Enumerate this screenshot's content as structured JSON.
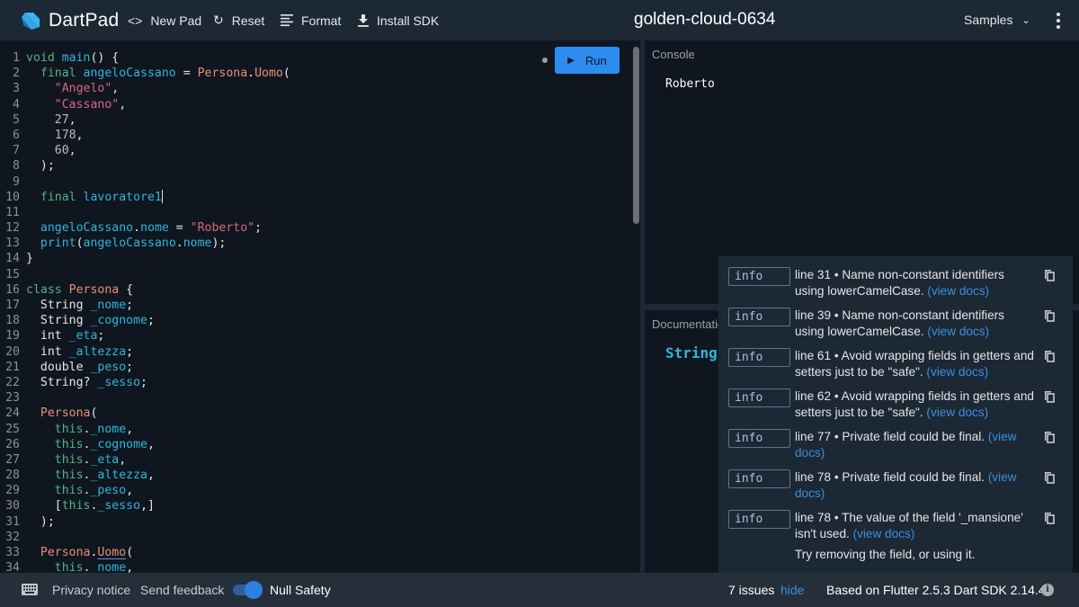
{
  "header": {
    "app_name": "DartPad",
    "new_pad_label": "New Pad",
    "reset_label": "Reset",
    "format_label": "Format",
    "install_sdk_label": "Install SDK",
    "pad_title": "golden-cloud-0634",
    "samples_label": "Samples"
  },
  "editor": {
    "run_label": "Run",
    "lines": [
      {
        "n": "1",
        "tokens": [
          [
            "kw",
            "void "
          ],
          [
            "id",
            "main"
          ],
          [
            "pl",
            "() {"
          ]
        ]
      },
      {
        "n": "2",
        "tokens": [
          [
            "pl",
            "  "
          ],
          [
            "kw",
            "final "
          ],
          [
            "id",
            "angeloCassano"
          ],
          [
            "pl",
            " = "
          ],
          [
            "ty",
            "Persona"
          ],
          [
            "pl",
            "."
          ],
          [
            "ty",
            "Uomo"
          ],
          [
            "pl",
            "("
          ]
        ]
      },
      {
        "n": "3",
        "tokens": [
          [
            "pl",
            "    "
          ],
          [
            "str",
            "\"Angelo\""
          ],
          [
            "pl",
            ","
          ]
        ]
      },
      {
        "n": "4",
        "tokens": [
          [
            "pl",
            "    "
          ],
          [
            "str",
            "\"Cassano\""
          ],
          [
            "pl",
            ","
          ]
        ]
      },
      {
        "n": "5",
        "tokens": [
          [
            "pl",
            "    "
          ],
          [
            "num",
            "27"
          ],
          [
            "pl",
            ","
          ]
        ]
      },
      {
        "n": "6",
        "tokens": [
          [
            "pl",
            "    "
          ],
          [
            "num",
            "178"
          ],
          [
            "pl",
            ","
          ]
        ]
      },
      {
        "n": "7",
        "tokens": [
          [
            "pl",
            "    "
          ],
          [
            "num",
            "60"
          ],
          [
            "pl",
            ","
          ]
        ]
      },
      {
        "n": "8",
        "tokens": [
          [
            "pl",
            "  );"
          ]
        ]
      },
      {
        "n": "9",
        "tokens": []
      },
      {
        "n": "10",
        "tokens": [
          [
            "pl",
            "  "
          ],
          [
            "kw",
            "final "
          ],
          [
            "id",
            "lavoratore1"
          ],
          [
            "cursor",
            ""
          ]
        ]
      },
      {
        "n": "11",
        "tokens": []
      },
      {
        "n": "12",
        "tokens": [
          [
            "pl",
            "  "
          ],
          [
            "id",
            "angeloCassano"
          ],
          [
            "pl",
            "."
          ],
          [
            "id",
            "nome"
          ],
          [
            "pl",
            " = "
          ],
          [
            "str",
            "\"Roberto\""
          ],
          [
            "pl",
            ";"
          ]
        ]
      },
      {
        "n": "13",
        "tokens": [
          [
            "pl",
            "  "
          ],
          [
            "id",
            "print"
          ],
          [
            "pl",
            "("
          ],
          [
            "id",
            "angeloCassano"
          ],
          [
            "pl",
            "."
          ],
          [
            "id",
            "nome"
          ],
          [
            "pl",
            ");"
          ]
        ]
      },
      {
        "n": "14",
        "tokens": [
          [
            "pl",
            "}"
          ]
        ]
      },
      {
        "n": "15",
        "tokens": []
      },
      {
        "n": "16",
        "tokens": [
          [
            "kw",
            "class "
          ],
          [
            "ty",
            "Persona"
          ],
          [
            "pl",
            " {"
          ]
        ]
      },
      {
        "n": "17",
        "tokens": [
          [
            "pl",
            "  String "
          ],
          [
            "id",
            "_nome"
          ],
          [
            "pl",
            ";"
          ]
        ]
      },
      {
        "n": "18",
        "tokens": [
          [
            "pl",
            "  String "
          ],
          [
            "id",
            "_cognome"
          ],
          [
            "pl",
            ";"
          ]
        ]
      },
      {
        "n": "19",
        "tokens": [
          [
            "pl",
            "  int "
          ],
          [
            "id",
            "_eta"
          ],
          [
            "pl",
            ";"
          ]
        ]
      },
      {
        "n": "20",
        "tokens": [
          [
            "pl",
            "  int "
          ],
          [
            "id",
            "_altezza"
          ],
          [
            "pl",
            ";"
          ]
        ]
      },
      {
        "n": "21",
        "tokens": [
          [
            "pl",
            "  double "
          ],
          [
            "id",
            "_peso"
          ],
          [
            "pl",
            ";"
          ]
        ]
      },
      {
        "n": "22",
        "tokens": [
          [
            "pl",
            "  String? "
          ],
          [
            "id",
            "_sesso"
          ],
          [
            "pl",
            ";"
          ]
        ]
      },
      {
        "n": "23",
        "tokens": []
      },
      {
        "n": "24",
        "tokens": [
          [
            "pl",
            "  "
          ],
          [
            "ty",
            "Persona"
          ],
          [
            "pl",
            "("
          ]
        ]
      },
      {
        "n": "25",
        "tokens": [
          [
            "pl",
            "    "
          ],
          [
            "kw",
            "this"
          ],
          [
            "pl",
            "."
          ],
          [
            "id",
            "_nome"
          ],
          [
            "pl",
            ","
          ]
        ]
      },
      {
        "n": "26",
        "tokens": [
          [
            "pl",
            "    "
          ],
          [
            "kw",
            "this"
          ],
          [
            "pl",
            "."
          ],
          [
            "id",
            "_cognome"
          ],
          [
            "pl",
            ","
          ]
        ]
      },
      {
        "n": "27",
        "tokens": [
          [
            "pl",
            "    "
          ],
          [
            "kw",
            "this"
          ],
          [
            "pl",
            "."
          ],
          [
            "id",
            "_eta"
          ],
          [
            "pl",
            ","
          ]
        ]
      },
      {
        "n": "28",
        "tokens": [
          [
            "pl",
            "    "
          ],
          [
            "kw",
            "this"
          ],
          [
            "pl",
            "."
          ],
          [
            "id",
            "_altezza"
          ],
          [
            "pl",
            ","
          ]
        ]
      },
      {
        "n": "29",
        "tokens": [
          [
            "pl",
            "    "
          ],
          [
            "kw",
            "this"
          ],
          [
            "pl",
            "."
          ],
          [
            "id",
            "_peso"
          ],
          [
            "pl",
            ","
          ]
        ]
      },
      {
        "n": "30",
        "tokens": [
          [
            "pl",
            "    ["
          ],
          [
            "kw",
            "this"
          ],
          [
            "pl",
            "."
          ],
          [
            "id",
            "_sesso"
          ],
          [
            "pl",
            ",]"
          ]
        ]
      },
      {
        "n": "31",
        "tokens": [
          [
            "pl",
            "  );"
          ]
        ]
      },
      {
        "n": "32",
        "tokens": []
      },
      {
        "n": "33",
        "tokens": [
          [
            "pl",
            "  "
          ],
          [
            "ty",
            "Persona"
          ],
          [
            "pl",
            "."
          ],
          [
            "squig",
            "Uomo"
          ],
          [
            "pl",
            "("
          ]
        ]
      },
      {
        "n": "34",
        "tokens": [
          [
            "pl",
            "    "
          ],
          [
            "kw",
            "this"
          ],
          [
            "pl",
            "."
          ],
          [
            "id",
            "_nome"
          ],
          [
            "pl",
            ","
          ]
        ]
      }
    ]
  },
  "console": {
    "label": "Console",
    "output": "Roberto"
  },
  "documentation": {
    "label": "Documentation",
    "signature": "String"
  },
  "issues": [
    {
      "severity": "info",
      "text": "line 31 • Name non-constant identifiers using lowerCamelCase.",
      "link": "(view docs)"
    },
    {
      "severity": "info",
      "text": "line 39 • Name non-constant identifiers using lowerCamelCase.",
      "link": "(view docs)"
    },
    {
      "severity": "info",
      "text": "line 61 • Avoid wrapping fields in getters and setters just to be \"safe\".",
      "link": "(view docs)"
    },
    {
      "severity": "info",
      "text": "line 62 • Avoid wrapping fields in getters and setters just to be \"safe\".",
      "link": "(view docs)"
    },
    {
      "severity": "info",
      "text": "line 77 • Private field could be final.",
      "link": "(view docs)"
    },
    {
      "severity": "info",
      "text": "line 78 • Private field could be final.",
      "link": "(view docs)"
    },
    {
      "severity": "info",
      "text": "line 78 • The value of the field '_mansione' isn't used.",
      "link": "(view docs)",
      "fix": "Try removing the field, or using it."
    }
  ],
  "footer": {
    "privacy_label": "Privacy notice",
    "feedback_label": "Send feedback",
    "null_safety_label": "Null Safety",
    "null_safety_on": true,
    "issues_count": "7 issues",
    "hide_label": "hide",
    "sdk_info": "Based on Flutter 2.5.3 Dart SDK 2.14.4"
  },
  "colors": {
    "accent": "#2d8cf0",
    "header_bg": "#1c2834",
    "editor_bg": "#0f1620",
    "link": "#3d8fe0"
  }
}
